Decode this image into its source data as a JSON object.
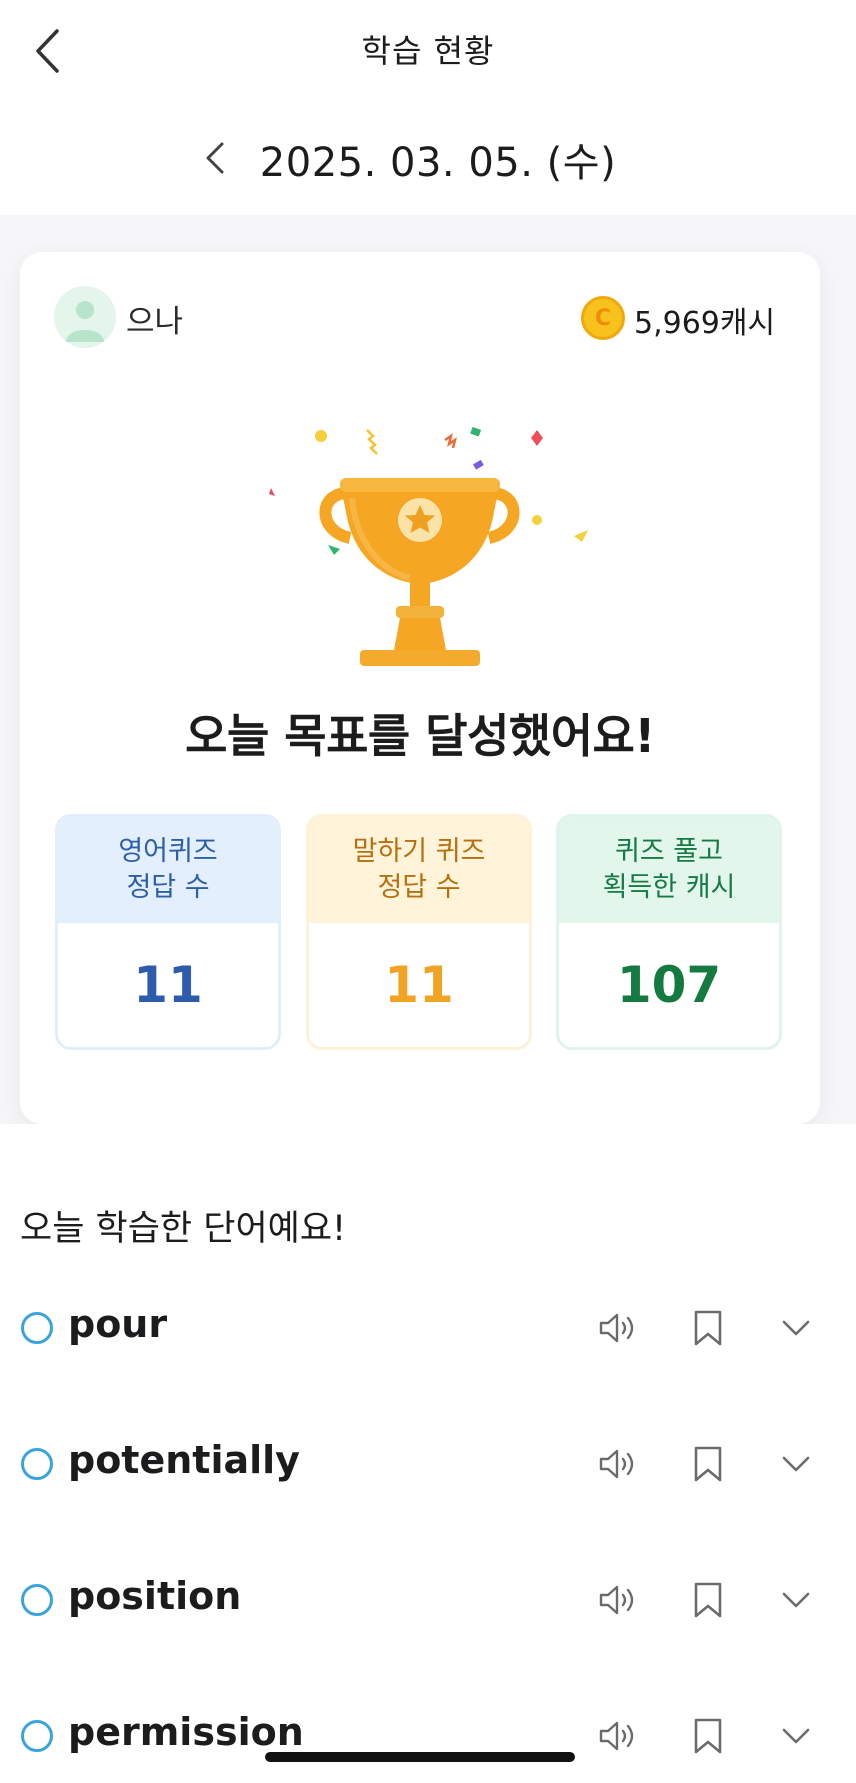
{
  "header": {
    "title": "학습 현황",
    "date": "2025. 03. 05. (수)"
  },
  "profile": {
    "name": "으나",
    "cash": "5,969캐시",
    "coin_symbol": "C"
  },
  "goal_message": "오늘 목표를 달성했어요!",
  "stats": [
    {
      "label": "영어퀴즈\n정답 수",
      "value": "11",
      "color": "#2c5cab"
    },
    {
      "label": "말하기 퀴즈\n정답 수",
      "value": "11",
      "color": "#f1a424"
    },
    {
      "label": "퀴즈 풀고\n획득한 캐시",
      "value": "107",
      "color": "#137a40"
    }
  ],
  "words_section": {
    "title": "오늘 학습한 단어예요!",
    "words": [
      {
        "word": "pour"
      },
      {
        "word": "potentially"
      },
      {
        "word": "position"
      },
      {
        "word": "permission"
      }
    ]
  },
  "icons": {
    "back": "chevron-left-icon",
    "date_prev": "chevron-left-icon",
    "sound": "speaker-icon",
    "bookmark": "bookmark-icon",
    "expand": "chevron-down-icon",
    "trophy": "trophy-icon"
  }
}
